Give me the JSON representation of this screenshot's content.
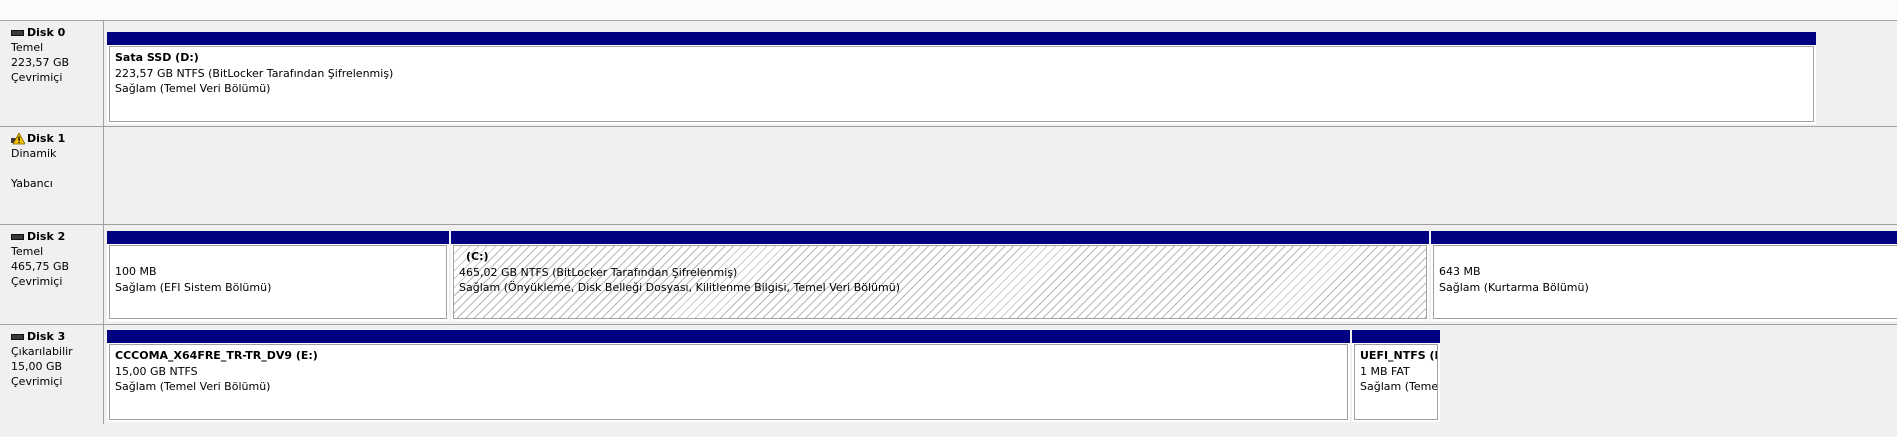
{
  "disks": [
    {
      "name": "Disk 0",
      "type": "Temel",
      "size": "223,57 GB",
      "status": "Çevrimiçi",
      "partitions": [
        {
          "name": "Sata SSD  (D:)",
          "details": "223,57 GB NTFS (BitLocker Tarafından Şifrelenmiş)",
          "health": "Sağlam (Temel Veri Bölümü)"
        }
      ]
    },
    {
      "name": "Disk 1",
      "type": "Dinamik",
      "status": "Yabancı",
      "icon": "warning-icon",
      "partitions": []
    },
    {
      "name": "Disk 2",
      "type": "Temel",
      "size": "465,75 GB",
      "status": "Çevrimiçi",
      "partitions": [
        {
          "details": "100 MB",
          "health": "Sağlam (EFI Sistem Bölümü)"
        },
        {
          "name": "(C:)",
          "details": "465,02 GB NTFS (BitLocker Tarafından Şifrelenmiş)",
          "health": "Sağlam (Önyükleme, Disk Belleği Dosyası, Kilitlenme Bilgisi, Temel Veri Bölümü)",
          "selected": true
        },
        {
          "details": "643 MB",
          "health": "Sağlam (Kurtarma Bölümü)"
        }
      ]
    },
    {
      "name": "Disk 3",
      "type": "Çıkarılabilir",
      "size": "15,00 GB",
      "status": "Çevrimiçi",
      "partitions": [
        {
          "name": "CCCOMA_X64FRE_TR-TR_DV9  (E:)",
          "details": "15,00 GB NTFS",
          "health": "Sağlam (Temel Veri Bölümü)"
        },
        {
          "name": "UEFI_NTFS  (F",
          "details": "1 MB FAT",
          "health": "Sağlam (Teme"
        }
      ]
    }
  ],
  "colors": {
    "partition_header": "#000080",
    "background": "#f0f0f0",
    "partition_body": "#ffffff"
  }
}
